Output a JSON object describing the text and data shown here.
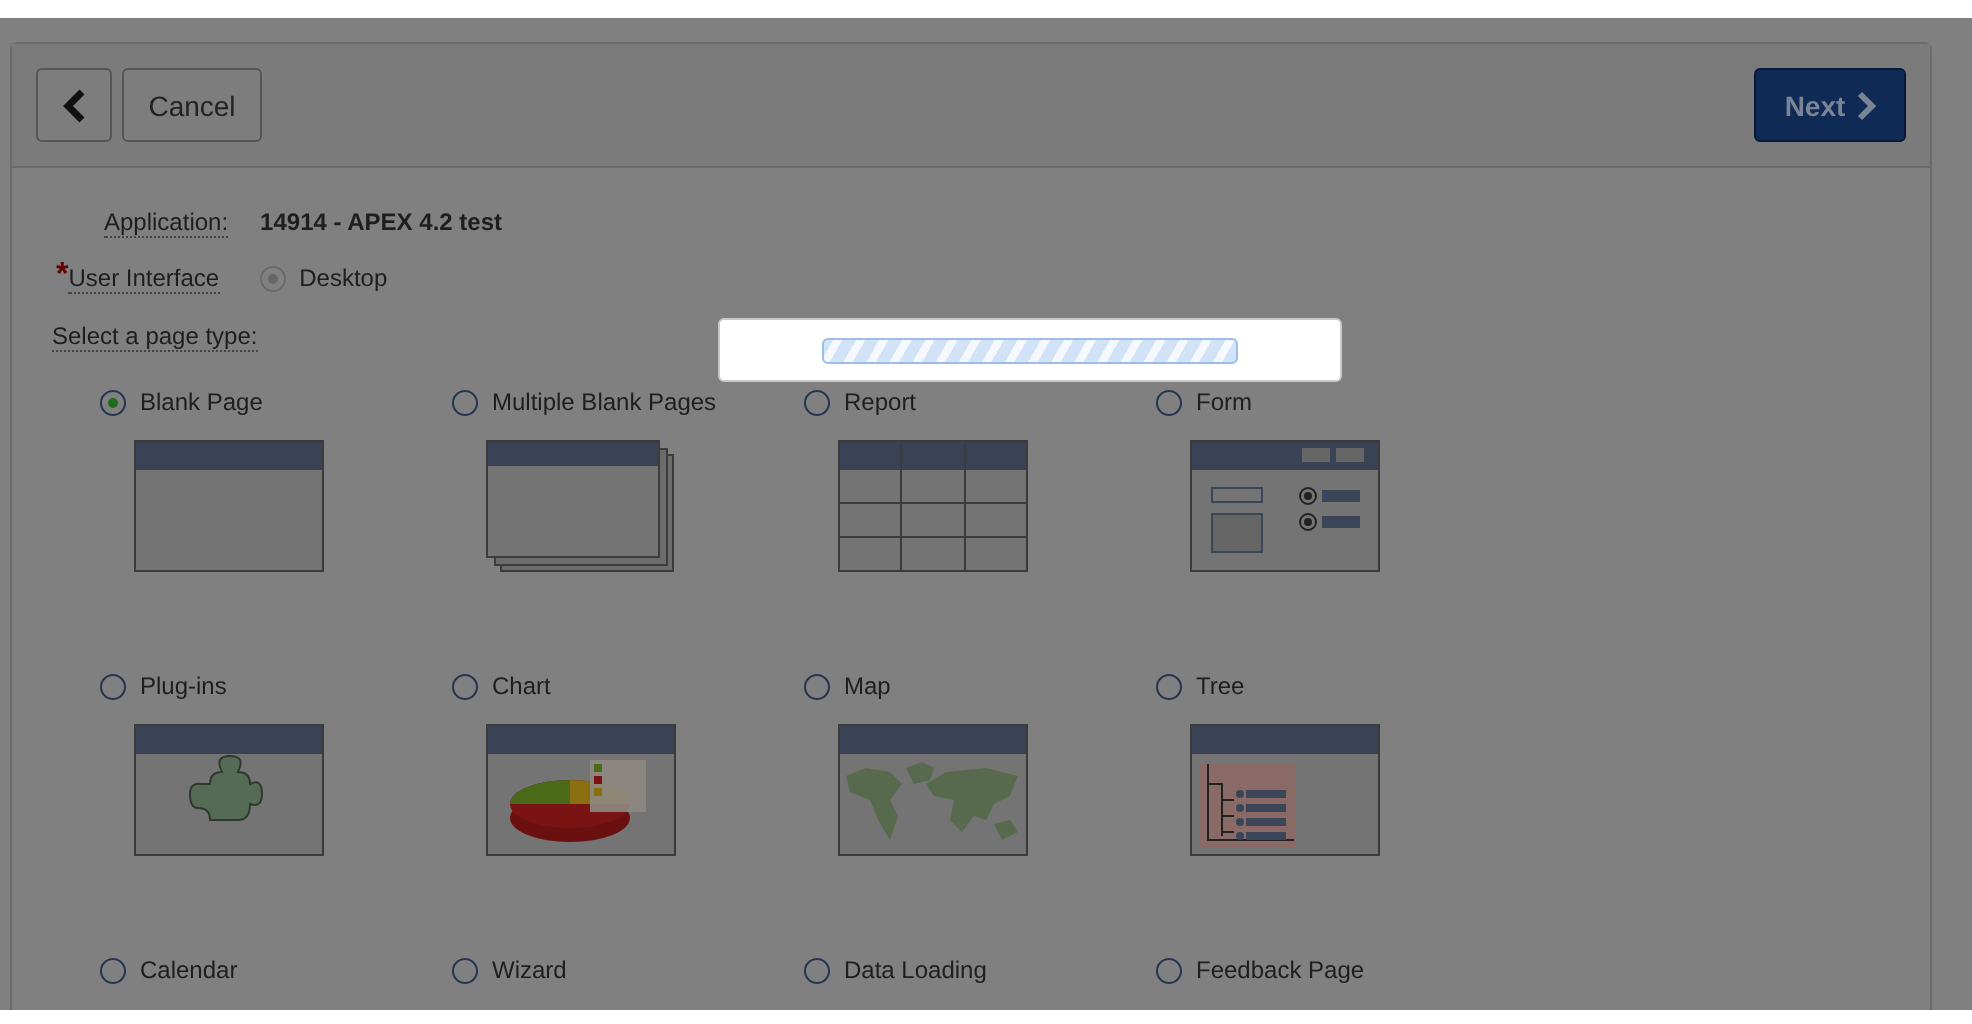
{
  "toolbar": {
    "cancel": {
      "label": "Cancel"
    },
    "next": {
      "label": "Next"
    }
  },
  "application": {
    "label": "Application:",
    "value": "14914 - APEX 4.2 test"
  },
  "user_interface": {
    "label": "User Interface",
    "required_mark": "*",
    "options": [
      {
        "label": "Desktop",
        "selected": true
      }
    ]
  },
  "page_type_label": "Select a page type:",
  "page_types": [
    {
      "label": "Blank Page",
      "selected": true,
      "kind": "blank"
    },
    {
      "label": "Multiple Blank Pages",
      "selected": false,
      "kind": "multiple"
    },
    {
      "label": "Report",
      "selected": false,
      "kind": "report"
    },
    {
      "label": "Form",
      "selected": false,
      "kind": "form"
    },
    {
      "label": "Plug-ins",
      "selected": false,
      "kind": "plugin"
    },
    {
      "label": "Chart",
      "selected": false,
      "kind": "chart"
    },
    {
      "label": "Map",
      "selected": false,
      "kind": "map"
    },
    {
      "label": "Tree",
      "selected": false,
      "kind": "tree"
    },
    {
      "label": "Calendar",
      "selected": false,
      "kind": "calendar"
    },
    {
      "label": "Wizard",
      "selected": false,
      "kind": "wizard"
    },
    {
      "label": "Data Loading",
      "selected": false,
      "kind": "dataload"
    },
    {
      "label": "Feedback Page",
      "selected": false,
      "kind": "feedback"
    }
  ],
  "loading": {
    "level": 1
  }
}
